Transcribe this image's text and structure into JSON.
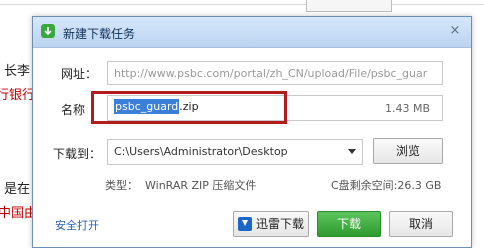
{
  "background": {
    "frag_1": "长李",
    "frag_2": "行银行",
    "frag_3": "是在",
    "frag_4": "中国由",
    "red_text_color": "#c00000"
  },
  "dialog": {
    "title": "新建下载任务",
    "close_glyph": "×",
    "url_label": "网址：",
    "url_value": "http://www.psbc.com/portal/zh_CN/upload/File/psbc_guar",
    "name_label": "名称",
    "name_selected": "psbc_guard",
    "name_rest": ".zip",
    "file_size": "1.43 MB",
    "save_label": "下载到：",
    "save_path": "C:\\Users\\Administrator\\Desktop",
    "browse_label": "浏览",
    "type_label": "类型：",
    "type_value": "WinRAR ZIP 压缩文件",
    "free_space": "C盘剩余空间:26.3 GB",
    "secure_open_label": "安全打开",
    "xunlei_label": "迅雷下载",
    "download_label": "下载",
    "cancel_label": "取消"
  },
  "colors": {
    "title_gradient_top": "#d6e7fb",
    "selection": "#3b7fd9",
    "highlight_box": "#b21c1c",
    "download_green": "#2e9b2e"
  }
}
